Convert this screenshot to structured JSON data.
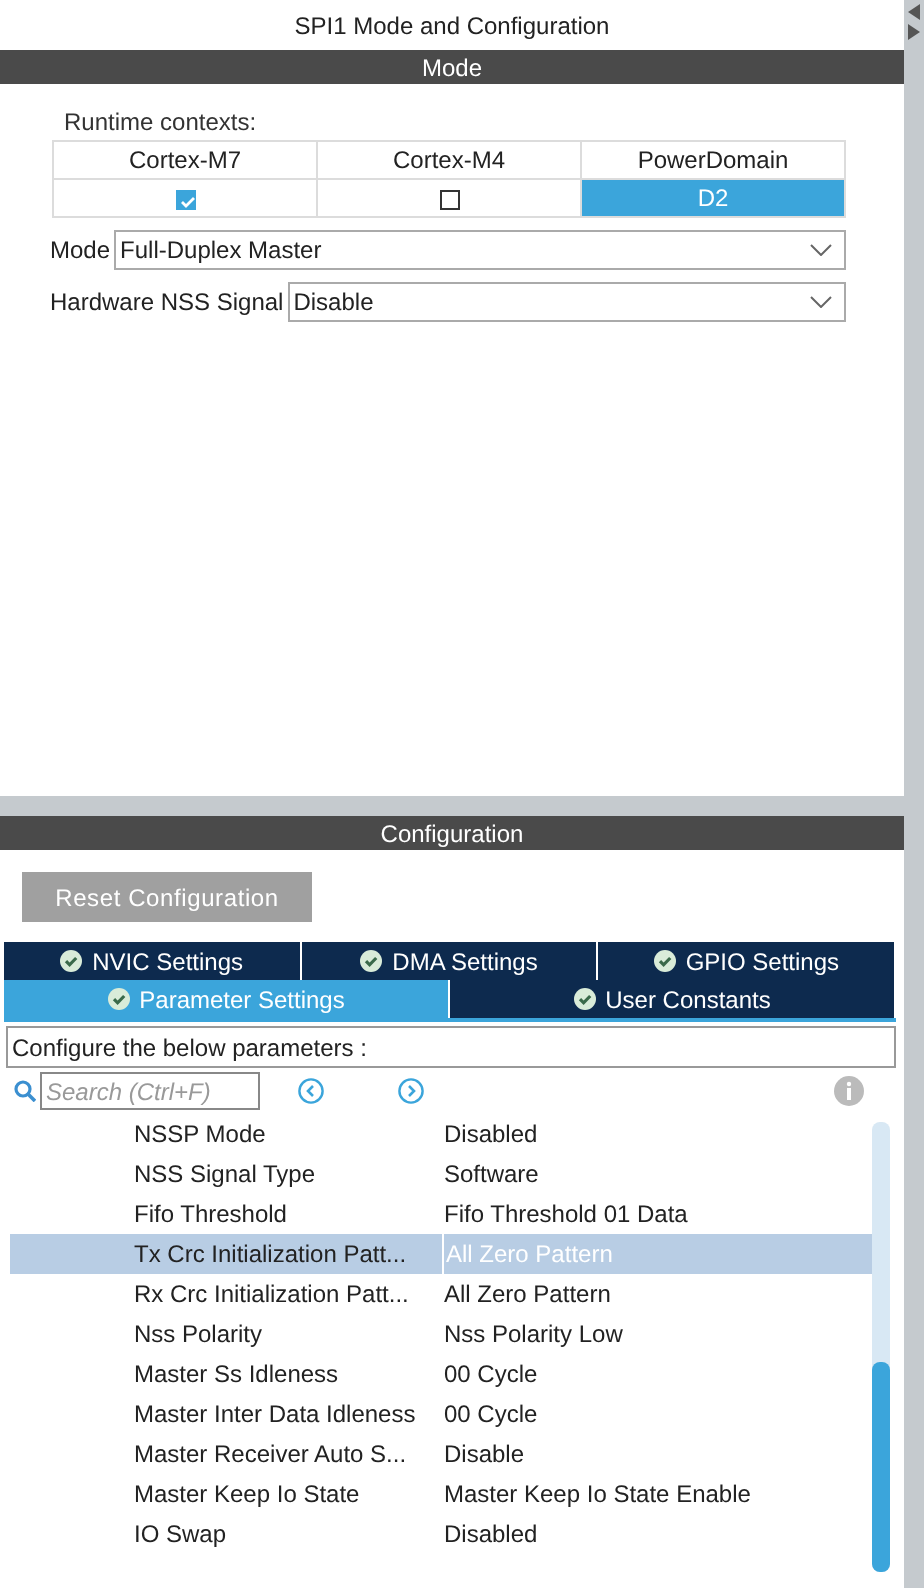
{
  "window": {
    "title": "SPI1 Mode and Configuration"
  },
  "mode_section": {
    "header": "Mode",
    "runtime_label": "Runtime contexts:",
    "contexts": [
      {
        "kind": "checkbox",
        "label": "Cortex-M7",
        "checked": true
      },
      {
        "kind": "checkbox",
        "label": "Cortex-M4",
        "checked": false
      },
      {
        "kind": "value",
        "label": "PowerDomain",
        "value": "D2"
      }
    ],
    "fields": [
      {
        "label": "Mode",
        "value": "Full-Duplex Master"
      },
      {
        "label": "Hardware NSS Signal",
        "value": "Disable"
      }
    ]
  },
  "configuration": {
    "header": "Configuration",
    "reset_button": "Reset Configuration",
    "tab_rows": [
      [
        {
          "label": "NVIC Settings",
          "selected": false
        },
        {
          "label": "DMA Settings",
          "selected": false
        },
        {
          "label": "GPIO Settings",
          "selected": false
        }
      ],
      [
        {
          "label": "Parameter Settings",
          "selected": true
        },
        {
          "label": "User Constants",
          "selected": false
        }
      ]
    ],
    "hint": "Configure the below parameters :",
    "search": {
      "placeholder": "Search (Ctrl+F)"
    },
    "parameters": [
      {
        "name": "NSSP Mode",
        "value": "Disabled",
        "selected": false
      },
      {
        "name": "NSS Signal Type",
        "value": "Software",
        "selected": false
      },
      {
        "name": "Fifo Threshold",
        "value": "Fifo Threshold 01 Data",
        "selected": false
      },
      {
        "name": "Tx Crc Initialization Patt...",
        "value": "All Zero Pattern",
        "selected": true
      },
      {
        "name": "Rx Crc Initialization Patt...",
        "value": "All Zero Pattern",
        "selected": false
      },
      {
        "name": "Nss Polarity",
        "value": "Nss Polarity Low",
        "selected": false
      },
      {
        "name": "Master Ss Idleness",
        "value": "00 Cycle",
        "selected": false
      },
      {
        "name": "Master Inter Data Idleness",
        "value": "00 Cycle",
        "selected": false
      },
      {
        "name": "Master Receiver Auto S...",
        "value": "Disable",
        "selected": false
      },
      {
        "name": "Master Keep Io State",
        "value": "Master Keep Io State Enable",
        "selected": false
      },
      {
        "name": "IO Swap",
        "value": "Disabled",
        "selected": false
      }
    ]
  }
}
